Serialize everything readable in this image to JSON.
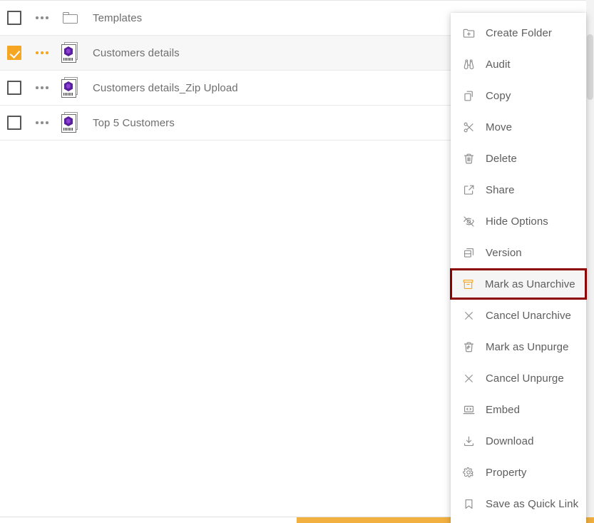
{
  "colors": {
    "accent_orange": "#f5a623",
    "highlight_border": "#8b0000",
    "highlight_bg": "#f5f5f5",
    "row_selected_bg": "#f7f7f7",
    "text_gray": "#6e6e6e",
    "icon_gray": "#8f8f8f",
    "birt_purple": "#5b1f9e"
  },
  "file_list": {
    "rows": [
      {
        "name": "Templates",
        "type": "folder",
        "icon": "folder-icon",
        "checked": false,
        "selected": false
      },
      {
        "name": "Customers details",
        "type": "rptdesign",
        "icon": "rptdesign-file-icon",
        "checked": true,
        "selected": true
      },
      {
        "name": "Customers details_Zip Upload",
        "type": "rptdesign",
        "icon": "rptdesign-file-icon",
        "checked": false,
        "selected": false
      },
      {
        "name": "Top 5 Customers",
        "type": "rptdesign",
        "icon": "rptdesign-file-icon",
        "checked": false,
        "selected": false
      }
    ]
  },
  "context_menu": {
    "items": [
      {
        "label": "Create Folder",
        "icon": "folder-plus-icon",
        "highlighted": false
      },
      {
        "label": "Audit",
        "icon": "binoculars-icon",
        "highlighted": false
      },
      {
        "label": "Copy",
        "icon": "copy-icon",
        "highlighted": false
      },
      {
        "label": "Move",
        "icon": "scissors-icon",
        "highlighted": false
      },
      {
        "label": "Delete",
        "icon": "trash-icon",
        "highlighted": false
      },
      {
        "label": "Share",
        "icon": "share-arrow-icon",
        "highlighted": false
      },
      {
        "label": "Hide Options",
        "icon": "eye-slash-icon",
        "highlighted": false
      },
      {
        "label": "Version",
        "icon": "layers-icon",
        "highlighted": false
      },
      {
        "label": "Mark as Unarchive",
        "icon": "archive-box-icon",
        "highlighted": true
      },
      {
        "label": "Cancel Unarchive",
        "icon": "close-x-icon",
        "highlighted": false
      },
      {
        "label": "Mark as Unpurge",
        "icon": "trash-undo-icon",
        "highlighted": false
      },
      {
        "label": "Cancel Unpurge",
        "icon": "close-x-icon",
        "highlighted": false
      },
      {
        "label": "Embed",
        "icon": "laptop-code-icon",
        "highlighted": false
      },
      {
        "label": "Download",
        "icon": "download-icon",
        "highlighted": false
      },
      {
        "label": "Property",
        "icon": "gear-icon",
        "highlighted": false
      },
      {
        "label": "Save as Quick Link",
        "icon": "bookmark-icon",
        "highlighted": false
      }
    ]
  }
}
